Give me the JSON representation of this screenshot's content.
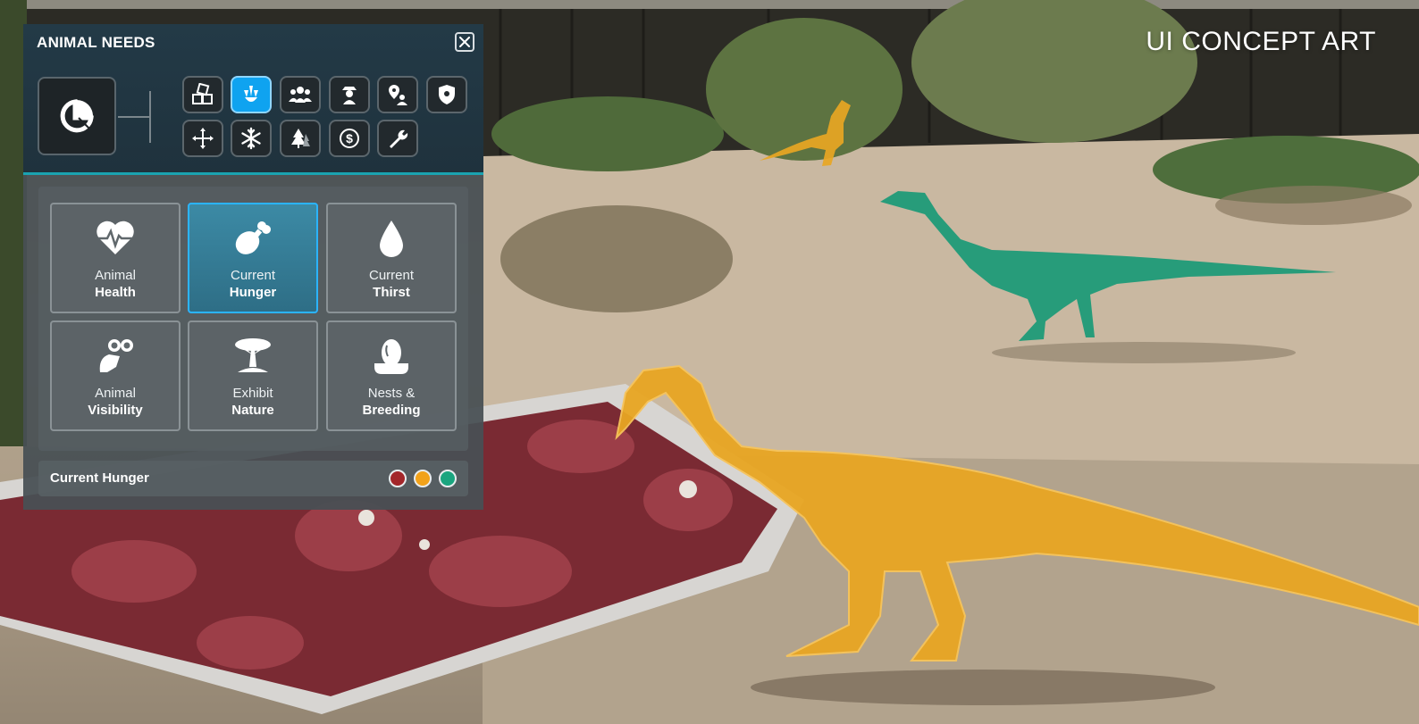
{
  "watermark": "UI CONCEPT ART",
  "panel": {
    "title": "ANIMAL NEEDS",
    "close_icon": "close-icon",
    "main_icon": "pie-chart-icon",
    "categories": [
      {
        "icon": "crates-icon",
        "active": false
      },
      {
        "icon": "claw-icon",
        "active": true
      },
      {
        "icon": "group-icon",
        "active": false
      },
      {
        "icon": "ranger-icon",
        "active": false
      },
      {
        "icon": "location-person-icon",
        "active": false
      },
      {
        "icon": "shield-badge-icon",
        "active": false
      },
      {
        "icon": "move-arrows-icon",
        "active": false
      },
      {
        "icon": "snowflake-icon",
        "active": false
      },
      {
        "icon": "trees-icon",
        "active": false
      },
      {
        "icon": "dollar-icon",
        "active": false
      },
      {
        "icon": "wrench-icon",
        "active": false
      }
    ],
    "tiles": [
      {
        "line1": "Animal",
        "line2": "Health",
        "icon": "heart-pulse-icon",
        "active": false
      },
      {
        "line1": "Current",
        "line2": "Hunger",
        "icon": "drumstick-icon",
        "active": true
      },
      {
        "line1": "Current",
        "line2": "Thirst",
        "icon": "water-drop-icon",
        "active": false
      },
      {
        "line1": "Animal",
        "line2": "Visibility",
        "icon": "binoculars-icon",
        "active": false
      },
      {
        "line1": "Exhibit",
        "line2": "Nature",
        "icon": "acacia-tree-icon",
        "active": false
      },
      {
        "line1": "Nests &",
        "line2": "Breeding",
        "icon": "egg-nest-icon",
        "active": false
      }
    ],
    "legend": {
      "label": "Current Hunger",
      "colors": [
        "#a3262a",
        "#f2a21a",
        "#1aa57f"
      ]
    }
  },
  "scene": {
    "highlight_colors": {
      "yellow": "#e8a623",
      "green": "#1f9a78"
    }
  }
}
